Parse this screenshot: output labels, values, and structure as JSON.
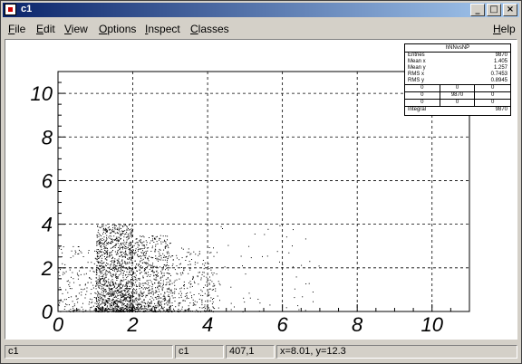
{
  "window": {
    "title": "c1"
  },
  "menu": {
    "file": {
      "u": "F",
      "rest": "ile"
    },
    "edit": {
      "u": "E",
      "rest": "dit"
    },
    "view": {
      "u": "V",
      "rest": "iew"
    },
    "options": {
      "u": "O",
      "rest": "ptions"
    },
    "inspect": {
      "u": "I",
      "rest": "nspect"
    },
    "classes": {
      "u": "C",
      "rest": "lasses"
    },
    "help": {
      "u": "H",
      "rest": "elp"
    }
  },
  "stats": {
    "title": "hNNvsNP",
    "rows": [
      {
        "k": "Entries",
        "v": "9870"
      },
      {
        "k": "Mean x",
        "v": "1.405"
      },
      {
        "k": "Mean y",
        "v": "1.257"
      },
      {
        "k": "RMS x",
        "v": "0.7453"
      },
      {
        "k": "RMS y",
        "v": "0.8945"
      }
    ],
    "grid": [
      "0",
      "0",
      "0",
      "0",
      "9870",
      "0",
      "0",
      "0",
      "0"
    ],
    "integral_label": "Integral",
    "integral_value": "9870"
  },
  "chart_data": {
    "type": "scatter",
    "title": "",
    "xlabel": "",
    "ylabel": "",
    "xlim": [
      0,
      11
    ],
    "ylim": [
      0,
      11
    ],
    "xticks": [
      "0",
      "2",
      "4",
      "6",
      "8",
      "10"
    ],
    "yticks": [
      "0",
      "2",
      "4",
      "6",
      "8",
      "10"
    ],
    "grid": true,
    "n_entries": 9870,
    "clusters": [
      {
        "x": [
          1.0,
          2.0
        ],
        "y": [
          0,
          4
        ],
        "density": "high"
      },
      {
        "x": [
          2.0,
          3.0
        ],
        "y": [
          0,
          3.5
        ],
        "density": "medium"
      },
      {
        "x": [
          3.0,
          4.2
        ],
        "y": [
          0,
          3
        ],
        "density": "low"
      },
      {
        "x": [
          0,
          1.0
        ],
        "y": [
          0,
          3
        ],
        "density": "sparse"
      },
      {
        "x": [
          4.2,
          7
        ],
        "y": [
          0,
          4
        ],
        "density": "very-sparse"
      }
    ]
  },
  "status": {
    "f1": "c1",
    "f2": "c1",
    "f3": "407,1",
    "f4": "x=8.01, y=12.3"
  }
}
